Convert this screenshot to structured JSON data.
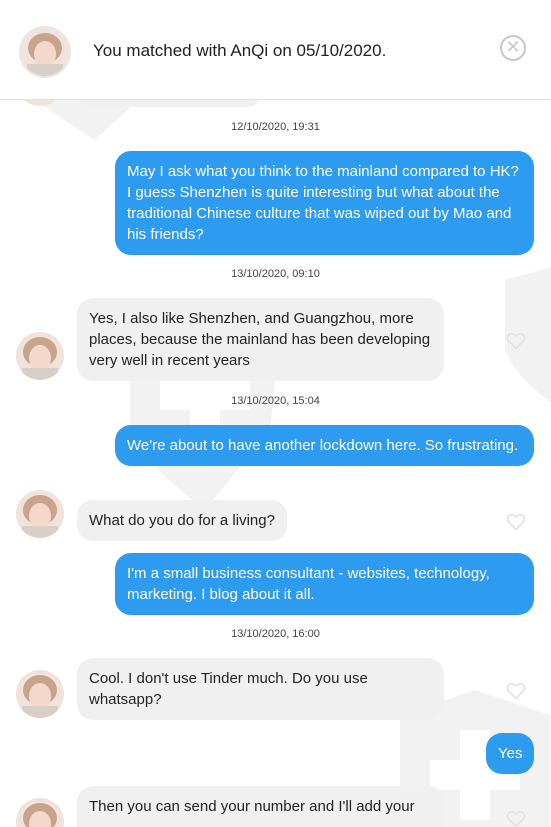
{
  "header": {
    "match_text": "You matched with AnQi on 05/10/2020."
  },
  "messages": {
    "ts1": "12/10/2020, 19:31",
    "m1": "May I ask what you think to the mainland compared to HK? I guess Shenzhen is quite interesting but what about the traditional Chinese culture that was wiped out by Mao and his friends?",
    "ts2": "13/10/2020, 09:10",
    "m2": "Yes, I also like Shenzhen, and Guangzhou, more places, because the mainland has been developing very well in recent years",
    "ts3": "13/10/2020, 15:04",
    "m3": "We're about to have another lockdown here. So frustrating.",
    "m4": "What do you do for a living?",
    "m5": "I'm a small business consultant - websites, technology, marketing. I blog about it all.",
    "ts4": "13/10/2020, 16:00",
    "m6": "Cool. I don't use Tinder much. Do you use whatsapp?",
    "m7": "Yes",
    "m8": "Then you can send your number and I'll add your"
  },
  "colors": {
    "sent_bubble": "#2d9bf0",
    "received_bubble": "#f0f0f0"
  }
}
